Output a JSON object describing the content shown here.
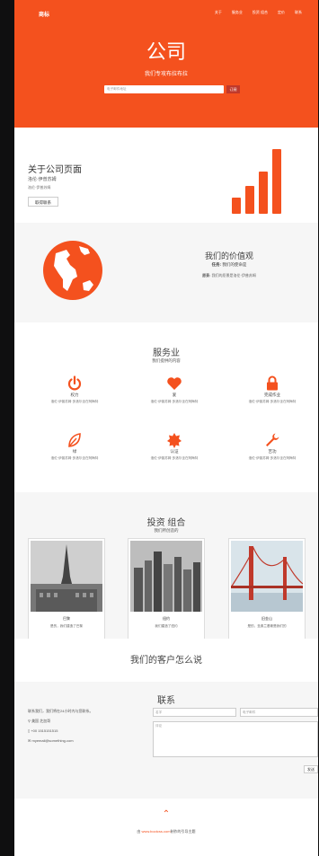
{
  "nav": {
    "brand": "商标",
    "links": [
      "关于",
      "服务业",
      "投资 组合",
      "定价",
      "联系"
    ]
  },
  "hero": {
    "title": "公司",
    "subtitle": "我们专攻布拉布拉",
    "email_placeholder": "电子邮件地址",
    "subscribe_label": "订阅"
  },
  "about": {
    "title": "关于公司页面",
    "line1": "洛伦·伊普苏姆",
    "line2": "洛伦·伊普苏姆",
    "button_label": "取得联系"
  },
  "values": {
    "title": "我们的价值观",
    "mission_label": "任务:",
    "mission_text": "我们的使命是",
    "vision_label": "愿景:",
    "vision_text": "我们的愿景是洛伦·伊普苏姆"
  },
  "services": {
    "title": "服务业",
    "subtitle": "我们提供的内容",
    "items": [
      {
        "icon": "power-icon",
        "name": "权力",
        "desc": "洛伦·伊普苏姆·多洛尔坐在阿梅特"
      },
      {
        "icon": "heart-icon",
        "name": "爱",
        "desc": "洛伦·伊普苏姆·多洛尔坐在阿梅特"
      },
      {
        "icon": "lock-icon",
        "name": "完成作业",
        "desc": "洛伦·伊普苏姆·多洛尔坐在阿梅特"
      },
      {
        "icon": "leaf-icon",
        "name": "绿",
        "desc": "洛伦·伊普苏姆·多洛尔坐在阿梅特"
      },
      {
        "icon": "certificate-icon",
        "name": "认证",
        "desc": "洛伦·伊普苏姆·多洛尔坐在阿梅特"
      },
      {
        "icon": "wrench-icon",
        "name": "苦功",
        "desc": "洛伦·伊普苏姆·多洛尔坐在阿梅特"
      }
    ]
  },
  "portfolio": {
    "title": "投资 组合",
    "subtitle": "我们所创造的",
    "items": [
      {
        "name": "巴黎",
        "desc": "是的，我们建造了巴黎"
      },
      {
        "name": "纽约",
        "desc": "我们建造了纽约"
      },
      {
        "name": "旧金山",
        "desc": "是的，圣弗兰基斯是我们的"
      }
    ]
  },
  "clients": {
    "title": "我们的客户怎么说"
  },
  "contact": {
    "title": "联系",
    "intro": "联系我们，我们将在24小时内与您联系。",
    "location": "美国 芝加哥",
    "phone": "+00 1515151515",
    "email": "myemail@something.com",
    "name_placeholder": "名字",
    "email_placeholder": "电子邮件",
    "comment_placeholder": "评论",
    "send_label": "发送"
  },
  "footer": {
    "up_glyph": "⌃",
    "credit_prefix": "由 ",
    "credit_link": "www.bootcss.com",
    "credit_suffix": "制作的引导主题"
  },
  "colors": {
    "accent": "#f4511e"
  }
}
